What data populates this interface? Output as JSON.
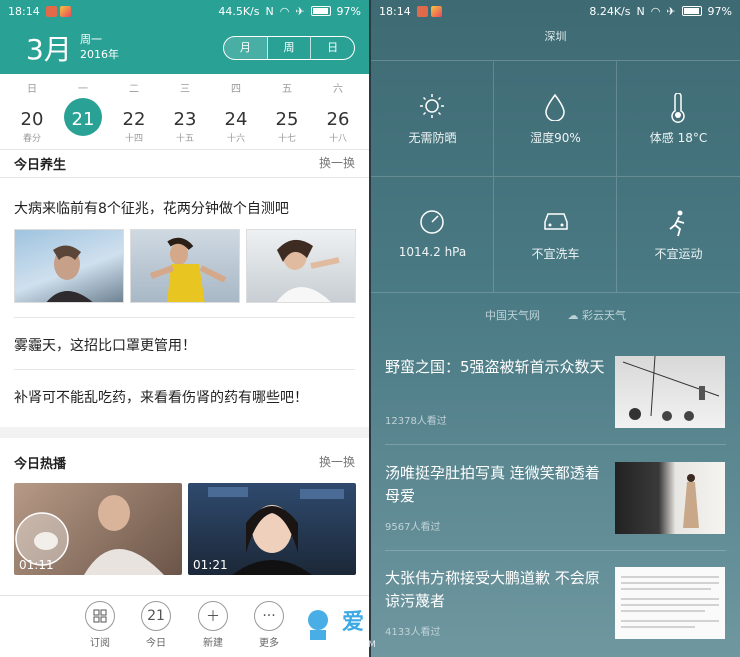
{
  "left": {
    "status": {
      "time": "18:14",
      "speed": "44.5K/s",
      "battery": "97%"
    },
    "header": {
      "month": "3月",
      "weekday": "周一",
      "year": "2016年",
      "tabs": [
        "月",
        "周",
        "日"
      ]
    },
    "week": {
      "weekdays": [
        "日",
        "一",
        "二",
        "三",
        "四",
        "五",
        "六"
      ],
      "dates": [
        "20",
        "21",
        "22",
        "23",
        "24",
        "25",
        "26"
      ],
      "lunar": [
        "春分",
        "",
        "十四",
        "十五",
        "十六",
        "十七",
        "十八"
      ]
    },
    "health": {
      "title": "今日养生",
      "action": "换一换",
      "articles": [
        "大病来临前有8个征兆，花两分钟做个自测吧",
        "雾霾天，这招比口罩更管用！",
        "补肾可不能乱吃药，来看看伤肾的药有哪些吧！"
      ]
    },
    "hot": {
      "title": "今日热播",
      "action": "换一换",
      "durations": [
        "01:11",
        "01:21"
      ]
    },
    "nav": {
      "items": [
        "订阅",
        "今日",
        "新建",
        "更多"
      ],
      "today_num": "21"
    }
  },
  "right": {
    "status": {
      "time": "18:14",
      "speed": "8.24K/s",
      "battery": "97%"
    },
    "city": "深圳",
    "weather": [
      "无需防晒",
      "湿度90%",
      "体感 18°C",
      "1014.2 hPa",
      "不宜洗车",
      "不宜运动"
    ],
    "sources": [
      "中国天气网",
      "彩云天气"
    ],
    "news": [
      {
        "title": "野蛮之国：5强盗被斩首示众数天",
        "views": "12378人看过"
      },
      {
        "title": "汤唯挺孕肚拍写真 连微笑都透着母爱",
        "views": "9567人看过"
      },
      {
        "title": "大张伟方称接受大鹏道歉 不会原谅污蔑者",
        "views": "4133人看过"
      }
    ],
    "watermark": {
      "text": "爱",
      "url": "www.GAO7.COM"
    }
  },
  "colors": {
    "accent": "#2aa195",
    "weather_bg": "#4a7a84"
  }
}
